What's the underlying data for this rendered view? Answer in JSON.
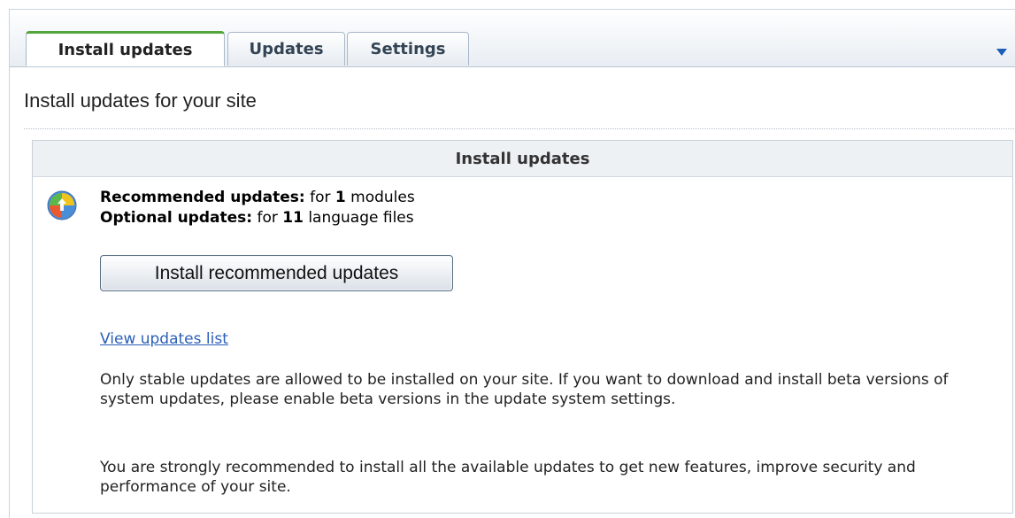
{
  "tabs": [
    {
      "label": "Install updates",
      "active": true
    },
    {
      "label": "Updates",
      "active": false
    },
    {
      "label": "Settings",
      "active": false
    }
  ],
  "page": {
    "title": "Install updates for your site"
  },
  "section": {
    "title": "Install updates",
    "recommended_label": "Recommended updates:",
    "recommended_prefix": "for",
    "recommended_count": "1",
    "recommended_suffix": "modules",
    "optional_label": "Optional updates:",
    "optional_prefix": "for",
    "optional_count": "11",
    "optional_suffix": "language files",
    "install_button": "Install recommended updates",
    "view_updates_link": "View updates list",
    "paragraph_1": "Only stable updates are allowed to be installed on your site. If you want to download and install beta versions of system updates, please enable beta versions in the update system settings.",
    "paragraph_2": "You are strongly recommended to install all the available updates to get new features, improve security and performance of your site."
  },
  "colors": {
    "active_tab_accent": "#53a53a",
    "link": "#2b60b8",
    "menu_arrow": "#1d5fb7"
  },
  "icons": {
    "tab_menu": "dropdown-triangle-icon",
    "update": "update-globe-icon"
  }
}
